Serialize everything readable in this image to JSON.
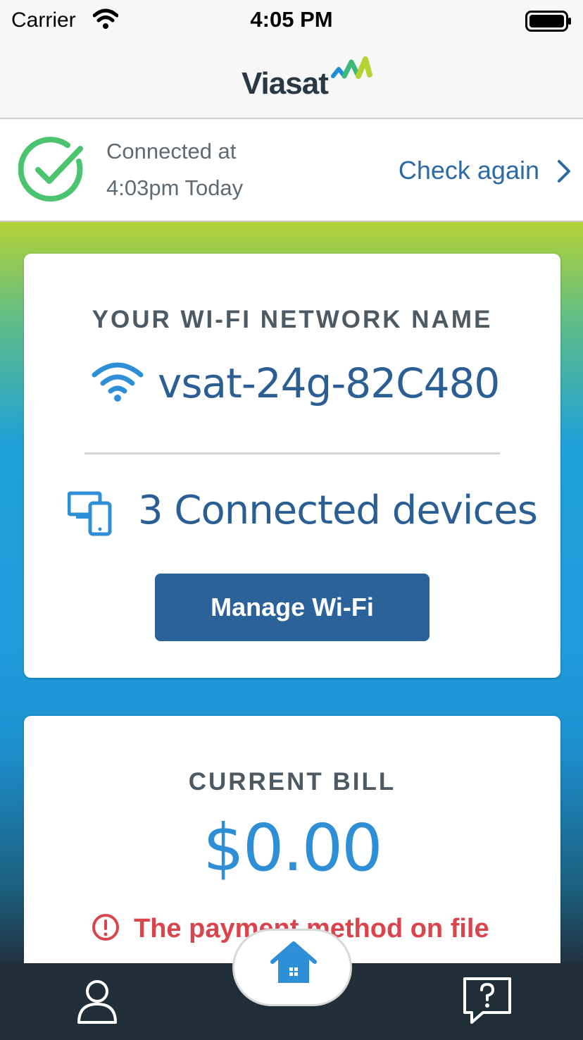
{
  "status_bar": {
    "carrier": "Carrier",
    "time": "4:05 PM"
  },
  "header": {
    "logo_text": "Viasat"
  },
  "connection": {
    "line1": "Connected at",
    "line2": "4:03pm Today",
    "check_again_label": "Check again",
    "status_color": "#4cc36f"
  },
  "wifi_card": {
    "heading": "YOUR WI-FI NETWORK NAME",
    "network_name": "vsat-24g-82C480",
    "devices_text": "3 Connected devices",
    "manage_button_label": "Manage Wi-Fi"
  },
  "bill_card": {
    "heading": "CURRENT BILL",
    "amount": "$0.00",
    "alert_text": "The payment method on file"
  },
  "tab_bar": {
    "items": [
      {
        "name": "profile",
        "icon": "user-icon"
      },
      {
        "name": "home",
        "icon": "home-icon",
        "active": true
      },
      {
        "name": "help",
        "icon": "help-chat-icon"
      }
    ]
  },
  "colors": {
    "accent": "#2b6299",
    "alert": "#d9444d",
    "tab_bar": "#202e38"
  }
}
